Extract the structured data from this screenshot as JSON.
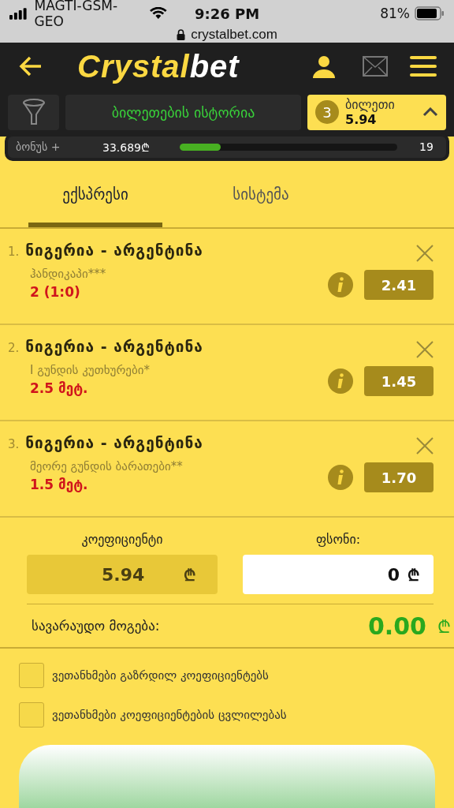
{
  "status_bar": {
    "carrier": "MAGTI-GSM-GEO",
    "time": "9:26 PM",
    "battery": "81%"
  },
  "address_bar": {
    "url": "crystalbet.com"
  },
  "header": {
    "logo_part_1": "Crystal",
    "logo_part_2": "bet"
  },
  "toolbar": {
    "history_button": "ბილეთების ისტორია",
    "ticket": {
      "count": "3",
      "label": "ბილეთი",
      "odds": "5.94",
      "expanded": true
    }
  },
  "bonus": {
    "label": "ბონუს +",
    "amount": "33.689₾",
    "level": 0.19,
    "count": "19"
  },
  "tabs": [
    {
      "label": "ექსპრესი",
      "selected": true
    },
    {
      "label": "სისტემა",
      "selected": false
    }
  ],
  "bets": [
    {
      "number": "1.",
      "match": "ნიგერია - არგენტინა",
      "market": "ჰანდიკაპი***",
      "pick": "2 (1:0)",
      "odds": "2.41"
    },
    {
      "number": "2.",
      "match": "ნიგერია - არგენტინა",
      "market": "I გუნდის კუთხურები*",
      "pick": "2.5 მეტ.",
      "odds": "1.45"
    },
    {
      "number": "3.",
      "match": "ნიგერია - არგენტინა",
      "market": "მეორე გუნდის ბარათები**",
      "pick": "1.5 მეტ.",
      "odds": "1.70"
    }
  ],
  "totals": {
    "odds_label": "კოეფიციენტი",
    "odds_value": "5.94",
    "odds_currency": "₾",
    "stake_label": "ფსონი:",
    "stake_value": "0",
    "stake_currency": "₾"
  },
  "profit": {
    "label": "სავარაუდო მოგება:",
    "value": "0.00",
    "currency": "₾"
  },
  "agreements": [
    {
      "label": "ვეთანხმები გაზრდილ კოეფიციენტებს",
      "checked": false
    },
    {
      "label": "ვეთანხმები კოეფიციენტების ცვლილებას",
      "checked": false
    }
  ]
}
